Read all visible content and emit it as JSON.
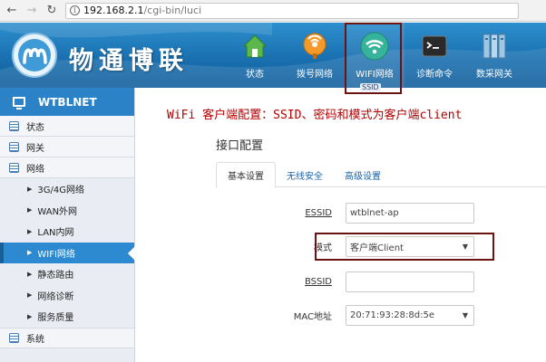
{
  "browser": {
    "url_host": "192.168.2.1",
    "url_path": "/cgi-bin/luci"
  },
  "header": {
    "brand": "物通博联",
    "menu": [
      {
        "label": "状态",
        "icon": "home-icon"
      },
      {
        "label": "拨号网络",
        "icon": "dialup-icon"
      },
      {
        "label": "WIFI网络",
        "icon": "wifi-icon"
      },
      {
        "label": "诊断命令",
        "icon": "terminal-icon"
      },
      {
        "label": "数采网关",
        "icon": "gateway-icon"
      }
    ],
    "tooltip": "SSID"
  },
  "sidebar": {
    "title": "WTBLNET",
    "sections": [
      {
        "label": "状态"
      },
      {
        "label": "网关"
      },
      {
        "label": "网络"
      }
    ],
    "network_items": [
      {
        "label": "3G/4G网络"
      },
      {
        "label": "WAN外网"
      },
      {
        "label": "LAN内网"
      },
      {
        "label": "WIFI网络"
      },
      {
        "label": "静态路由"
      },
      {
        "label": "网络诊断"
      },
      {
        "label": "服务质量"
      }
    ],
    "bottom_section": "系统"
  },
  "main": {
    "annotation": "WiFi 客户端配置：SSID、密码和模式为客户端client",
    "section_title": "接口配置",
    "tabs": [
      {
        "label": "基本设置"
      },
      {
        "label": "无线安全"
      },
      {
        "label": "高级设置"
      }
    ],
    "form": {
      "essid_label": "ESSID",
      "essid_value": "wtblnet-ap",
      "mode_label": "模式",
      "mode_value": "客户端Client",
      "bssid_label": "BSSID",
      "bssid_value": "",
      "mac_label": "MAC地址",
      "mac_value": "20:71:93:28:8d:5e"
    }
  },
  "colors": {
    "header_blue": "#1a70b0",
    "sidebar_active": "#2e8ad0",
    "annotation_red": "#b20000",
    "highlight_box": "#6b1313"
  }
}
